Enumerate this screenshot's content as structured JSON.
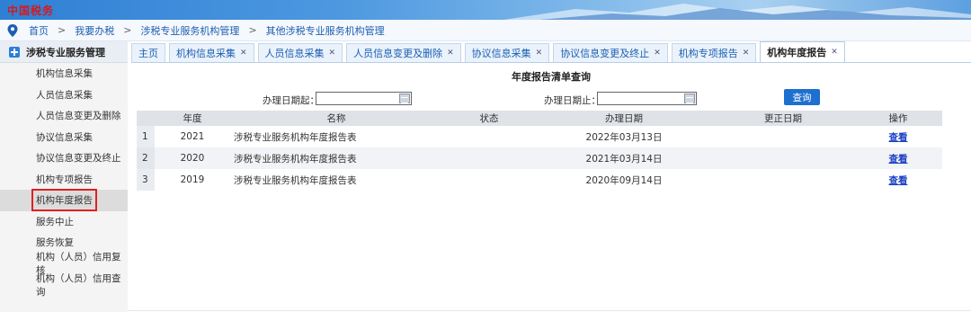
{
  "banner": {
    "logo_text": "中国税务"
  },
  "breadcrumb": [
    "首页",
    "我要办税",
    "涉税专业服务机构管理",
    "其他涉税专业服务机构管理"
  ],
  "sidebar": {
    "title": "涉税专业服务管理",
    "items": [
      {
        "label": "机构信息采集"
      },
      {
        "label": "人员信息采集"
      },
      {
        "label": "人员信息变更及删除"
      },
      {
        "label": "协议信息采集"
      },
      {
        "label": "协议信息变更及终止"
      },
      {
        "label": "机构专项报告"
      },
      {
        "label": "机构年度报告",
        "active": true
      },
      {
        "label": "服务中止"
      },
      {
        "label": "服务恢复"
      },
      {
        "label": "机构（人员）信用复核"
      },
      {
        "label": "机构（人员）信用查询"
      }
    ]
  },
  "tabs": [
    {
      "label": "主页",
      "closable": false
    },
    {
      "label": "机构信息采集",
      "closable": true
    },
    {
      "label": "人员信息采集",
      "closable": true
    },
    {
      "label": "人员信息变更及删除",
      "closable": true
    },
    {
      "label": "协议信息采集",
      "closable": true
    },
    {
      "label": "协议信息变更及终止",
      "closable": true
    },
    {
      "label": "机构专项报告",
      "closable": true
    },
    {
      "label": "机构年度报告",
      "closable": true,
      "active": true
    }
  ],
  "main": {
    "title": "年度报告清单查询",
    "filter": {
      "start_label": "办理日期起：",
      "start_value": "",
      "end_label": "办理日期止：",
      "end_value": "",
      "query_label": "查询"
    },
    "table": {
      "headers": [
        "",
        "年度",
        "名称",
        "状态",
        "办理日期",
        "更正日期",
        "操作"
      ],
      "rows": [
        {
          "num": "1",
          "year": "2021",
          "name": "涉税专业服务机构年度报告表",
          "status": "",
          "date": "2022年03月13日",
          "corr": "",
          "action": "查看"
        },
        {
          "num": "2",
          "year": "2020",
          "name": "涉税专业服务机构年度报告表",
          "status": "",
          "date": "2021年03月14日",
          "corr": "",
          "action": "查看"
        },
        {
          "num": "3",
          "year": "2019",
          "name": "涉税专业服务机构年度报告表",
          "status": "",
          "date": "2020年09月14日",
          "corr": "",
          "action": "查看"
        }
      ]
    }
  },
  "colors": {
    "link_blue": "#1c5fb2",
    "button_blue": "#1f6fd0",
    "highlight_red": "#e02020"
  }
}
